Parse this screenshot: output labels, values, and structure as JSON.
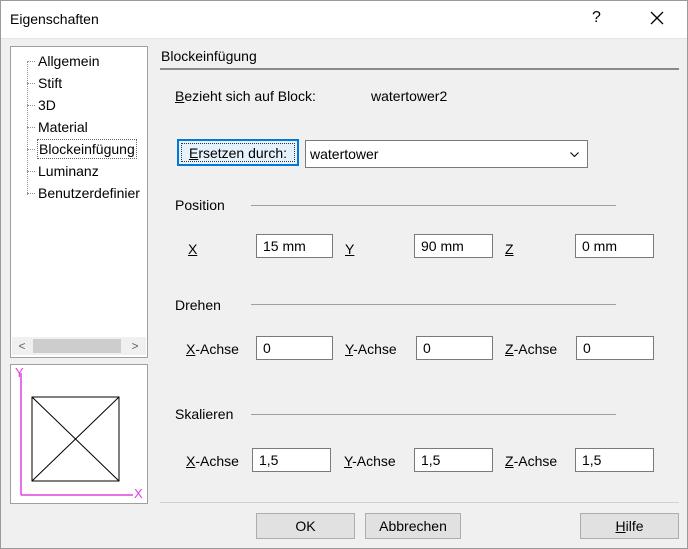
{
  "window": {
    "title": "Eigenschaften",
    "help_symbol": "?",
    "close_icon": "close-icon"
  },
  "tree": {
    "items": [
      {
        "label": "Allgemein",
        "selected": false
      },
      {
        "label": "Stift",
        "selected": false
      },
      {
        "label": "3D",
        "selected": false
      },
      {
        "label": "Material",
        "selected": false
      },
      {
        "label": "Blockeinfügung",
        "selected": true
      },
      {
        "label": "Luminanz",
        "selected": false
      },
      {
        "label": "Benutzerdefinier",
        "selected": false
      }
    ],
    "scroll_left": "<",
    "scroll_right": ">"
  },
  "preview": {
    "axis_y_label": "Y",
    "axis_x_label": "X",
    "axis_color": "#e040e0"
  },
  "section": {
    "title": "Blockeinfügung",
    "refers_label": "Bezieht sich auf Block:",
    "refers_value": "watertower2",
    "replace_button": "Ersetzen durch:",
    "replace_value": "watertower"
  },
  "position": {
    "title": "Position",
    "x_label": "X",
    "x_value": "15 mm",
    "y_label": "Y",
    "y_value": "90 mm",
    "z_label": "Z",
    "z_value": "0 mm"
  },
  "rotate": {
    "title": "Drehen",
    "x_label_key": "X",
    "x_label_rest": "-Achse",
    "x_value": "0",
    "y_label_key": "Y",
    "y_label_rest": "-Achse",
    "y_value": "0",
    "z_label_key": "Z",
    "z_label_rest": "-Achse",
    "z_value": "0"
  },
  "scale": {
    "title": "Skalieren",
    "x_label_key": "X",
    "x_label_rest": "-Achse",
    "x_value": "1,5",
    "y_label_key": "Y",
    "y_label_rest": "-Achse",
    "y_value": "1,5",
    "z_label_key": "Z",
    "z_label_rest": "-Achse",
    "z_value": "1,5"
  },
  "buttons": {
    "ok": "OK",
    "cancel": "Abbrechen",
    "help_key": "H",
    "help_rest": "ilfe"
  }
}
